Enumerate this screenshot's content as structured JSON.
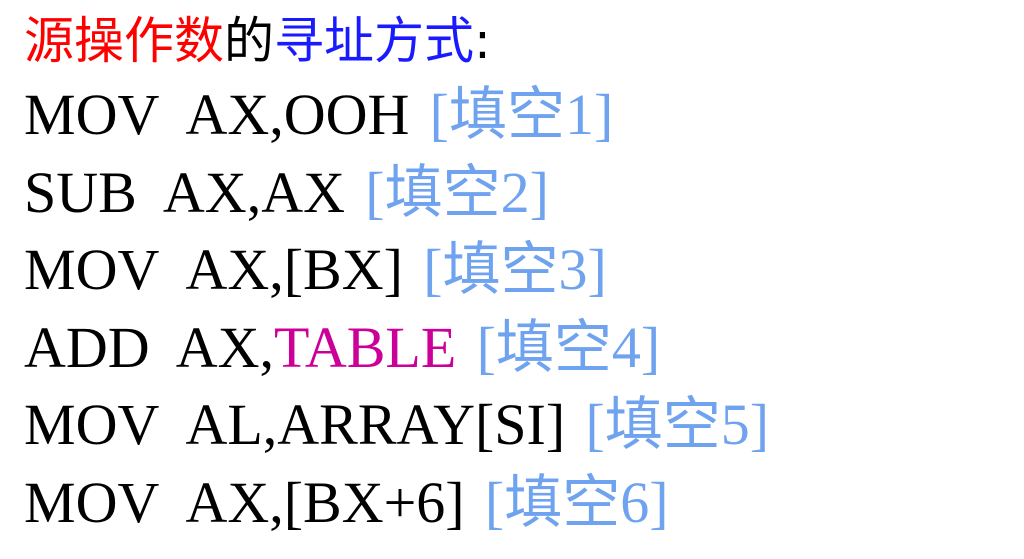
{
  "title": {
    "part1": "源操作数",
    "part2": "的",
    "part3": "寻址方式",
    "colon": ":"
  },
  "lines": [
    {
      "mnemonic": "MOV",
      "operands": "AX,OOH",
      "highlight": "",
      "blank": "[填空1]"
    },
    {
      "mnemonic": "SUB",
      "operands": "AX,AX",
      "highlight": "",
      "blank": "[填空2]"
    },
    {
      "mnemonic": "MOV",
      "operands": "AX,[BX]",
      "highlight": "",
      "blank": "[填空3]"
    },
    {
      "mnemonic": "ADD",
      "operands": "AX,",
      "highlight": "TABLE",
      "blank": "[填空4]"
    },
    {
      "mnemonic": "MOV",
      "operands": "AL,ARRAY[SI]",
      "highlight": "",
      "blank": "[填空5]"
    },
    {
      "mnemonic": "MOV",
      "operands": "AX,[BX+6]",
      "highlight": "",
      "blank": "[填空6]"
    }
  ],
  "colors": {
    "title_red": "#ff0000",
    "title_blue": "#1a1aff",
    "highlight": "#cc0099",
    "blank": "#6fa3ef"
  }
}
